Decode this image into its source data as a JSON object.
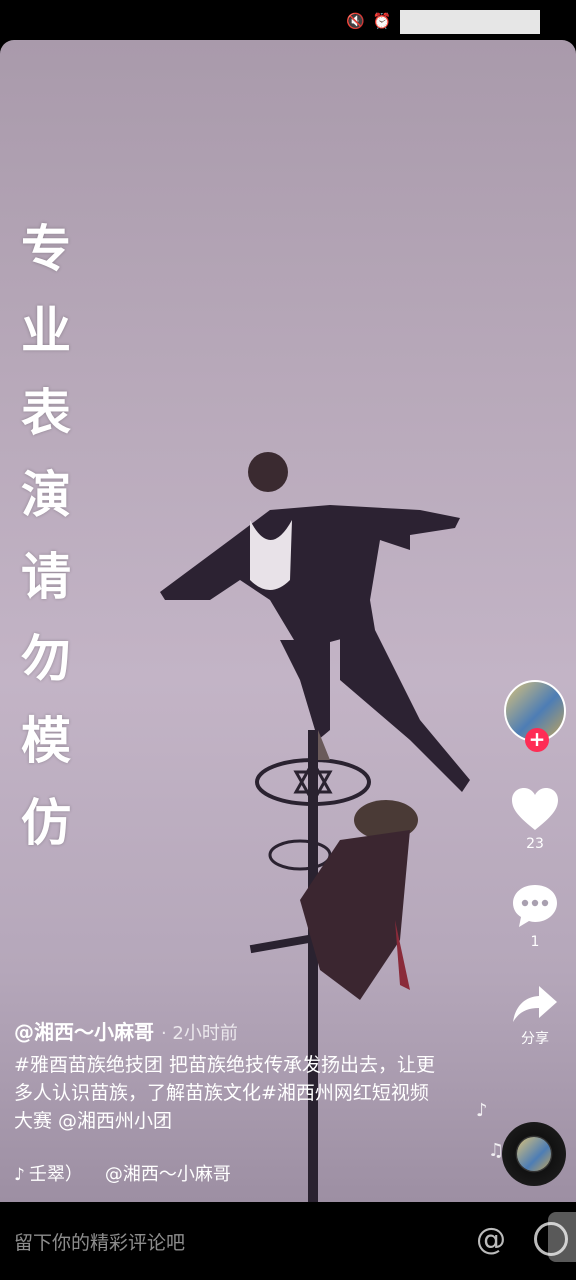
{
  "status_bar": {
    "icons": [
      "mute-icon",
      "alarm-icon"
    ]
  },
  "overlay": {
    "lines": [
      "专",
      "业",
      "表",
      "演",
      "请",
      "勿",
      "模",
      "仿"
    ]
  },
  "actions": {
    "like_count": "23",
    "comment_count": "1",
    "share_label": "分享"
  },
  "caption": {
    "author": "@湘西～小麻哥",
    "time": "· 2小时前",
    "description": "#雅酉苗族绝技团 把苗族绝技传承发扬出去，让更多人认识苗族，了解苗族文化#湘西州网红短视频大赛 @湘西州小团"
  },
  "music": {
    "title": "壬翠）",
    "author": "@湘西～小麻哥"
  },
  "comment_bar": {
    "placeholder": "留下你的精彩评论吧"
  },
  "colors": {
    "follow_badge": "#fe2c55",
    "sky": "#b8a9ba"
  }
}
